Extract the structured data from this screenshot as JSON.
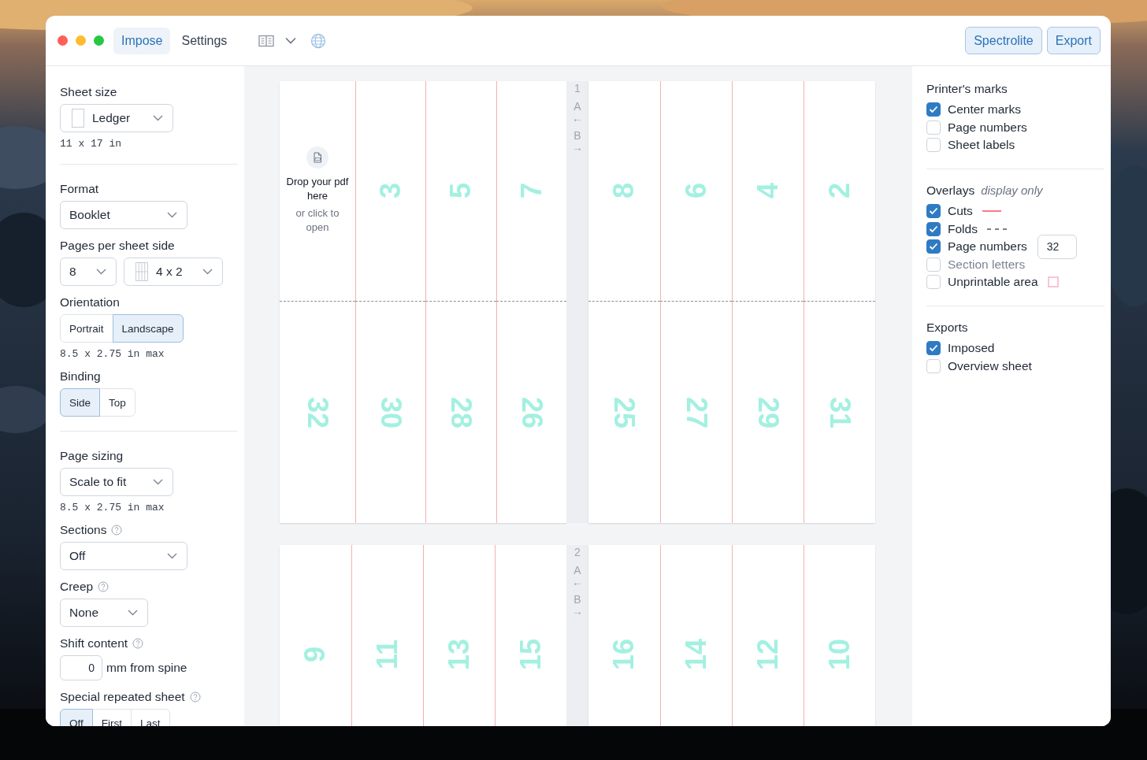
{
  "toolbar": {
    "tabs": [
      {
        "label": "Impose",
        "selected": true
      },
      {
        "label": "Settings",
        "selected": false
      }
    ],
    "buttons": [
      "Spectrolite",
      "Export"
    ]
  },
  "left_panel": {
    "sections": [
      [
        {
          "kind": "sheet_select",
          "label": "Sheet size",
          "help": false,
          "value": "Ledger",
          "note": "11 x 17 in"
        }
      ],
      [
        {
          "kind": "select",
          "label": "Format",
          "help": false,
          "value": "Booklet"
        },
        {
          "kind": "select_pair",
          "label": "Pages per sheet side",
          "help": false,
          "values": [
            "8",
            "4 x 2"
          ]
        },
        {
          "kind": "segmented",
          "label": "Orientation",
          "help": false,
          "options": [
            {
              "label": "Portrait",
              "selected": false
            },
            {
              "label": "Landscape",
              "selected": true
            }
          ],
          "note": "8.5 x 2.75 in max"
        },
        {
          "kind": "segmented",
          "label": "Binding",
          "help": false,
          "options": [
            {
              "label": "Side",
              "selected": true
            },
            {
              "label": "Top",
              "selected": false
            }
          ]
        }
      ],
      [
        {
          "kind": "select",
          "label": "Page sizing",
          "help": false,
          "value": "Scale to fit",
          "note": "8.5 x 2.75 in max"
        },
        {
          "kind": "select",
          "label": "Sections",
          "help": true,
          "value": "Off"
        },
        {
          "kind": "select",
          "label": "Creep",
          "help": true,
          "value": "None"
        },
        {
          "kind": "number",
          "label": "Shift content",
          "help": true,
          "value": "0",
          "suffix": "mm from spine"
        },
        {
          "kind": "segmented",
          "label": "Special repeated sheet",
          "help": true,
          "options": [
            {
              "label": "Off",
              "selected": true
            },
            {
              "label": "First",
              "selected": false
            },
            {
              "label": "Last",
              "selected": false
            }
          ]
        }
      ]
    ]
  },
  "sheets": [
    {
      "label": "1",
      "side_a": "A",
      "arrow_a": "←",
      "side_b": "B",
      "arrow_b": "→",
      "halves": [
        {
          "top_row": [
            {
              "kind": "drop",
              "title": "Drop your pdf here",
              "hint": "or click to open"
            },
            {
              "kind": "page",
              "number": "3"
            },
            {
              "kind": "page",
              "number": "5"
            },
            {
              "kind": "page",
              "number": "7"
            }
          ],
          "bottom_row": [
            {
              "kind": "page",
              "number": "32"
            },
            {
              "kind": "page",
              "number": "30"
            },
            {
              "kind": "page",
              "number": "28"
            },
            {
              "kind": "page",
              "number": "26"
            }
          ]
        },
        {
          "top_row": [
            {
              "kind": "page",
              "number": "8"
            },
            {
              "kind": "page",
              "number": "6"
            },
            {
              "kind": "page",
              "number": "4"
            },
            {
              "kind": "page",
              "number": "2"
            }
          ],
          "bottom_row": [
            {
              "kind": "page",
              "number": "25"
            },
            {
              "kind": "page",
              "number": "27"
            },
            {
              "kind": "page",
              "number": "29"
            },
            {
              "kind": "page",
              "number": "31"
            }
          ]
        }
      ]
    },
    {
      "label": "2",
      "side_a": "A",
      "arrow_a": "←",
      "side_b": "B",
      "arrow_b": "→",
      "halves": [
        {
          "top_row": [
            {
              "kind": "page",
              "number": "9"
            },
            {
              "kind": "page",
              "number": "11"
            },
            {
              "kind": "page",
              "number": "13"
            },
            {
              "kind": "page",
              "number": "15"
            }
          ]
        },
        {
          "top_row": [
            {
              "kind": "page",
              "number": "16"
            },
            {
              "kind": "page",
              "number": "14"
            },
            {
              "kind": "page",
              "number": "12"
            },
            {
              "kind": "page",
              "number": "10"
            }
          ]
        }
      ]
    }
  ],
  "right_panel": {
    "groups": [
      {
        "title": "Printer's marks",
        "items": [
          {
            "kind": "plain",
            "label": "Center marks",
            "checked": true,
            "disabled": false
          },
          {
            "kind": "plain",
            "label": "Page numbers",
            "checked": false,
            "disabled": false
          },
          {
            "kind": "plain",
            "label": "Sheet labels",
            "checked": false,
            "disabled": false
          }
        ]
      },
      {
        "title": "Overlays",
        "subtitle": "display only",
        "items": [
          {
            "kind": "cut_sample",
            "label": "Cuts",
            "checked": true,
            "disabled": false
          },
          {
            "kind": "fold_sample",
            "label": "Folds",
            "checked": true,
            "disabled": false
          },
          {
            "kind": "number_input",
            "label": "Page numbers",
            "checked": true,
            "disabled": false,
            "value": "32"
          },
          {
            "kind": "plain",
            "label": "Section letters",
            "checked": false,
            "disabled": true
          },
          {
            "kind": "area_sample",
            "label": "Unprintable area",
            "checked": false,
            "disabled": false
          }
        ]
      },
      {
        "title": "Exports",
        "items": [
          {
            "kind": "plain",
            "label": "Imposed",
            "checked": true,
            "disabled": false
          },
          {
            "kind": "plain",
            "label": "Overview sheet",
            "checked": false,
            "disabled": false
          }
        ]
      }
    ]
  }
}
